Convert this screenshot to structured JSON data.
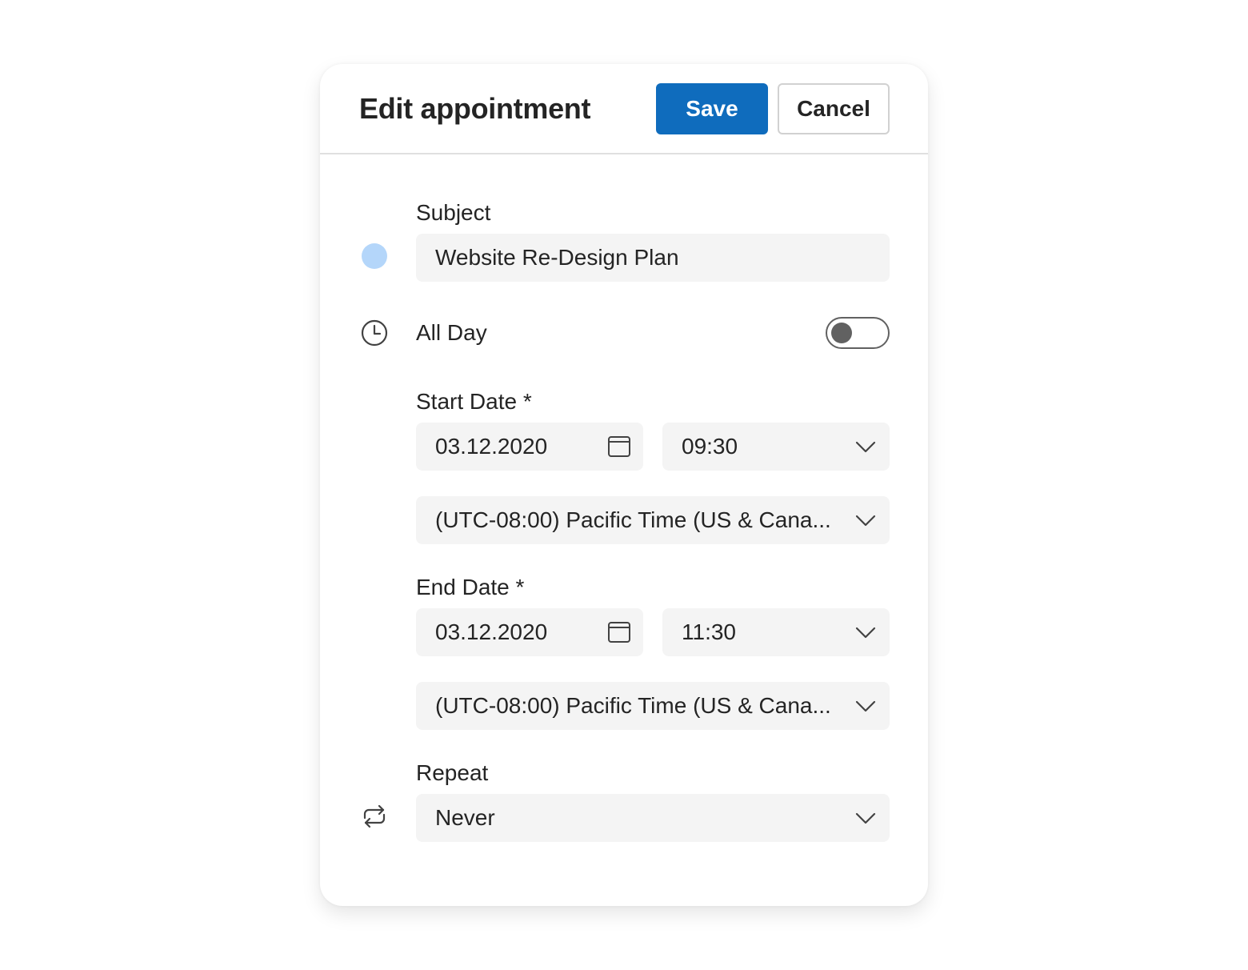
{
  "dialog": {
    "title": "Edit appointment",
    "save_label": "Save",
    "cancel_label": "Cancel",
    "accent_color": "#0f6cbd"
  },
  "subject": {
    "label": "Subject",
    "value": "Website Re-Design Plan",
    "category_color": "#b4d6fa"
  },
  "all_day": {
    "label": "All Day",
    "enabled": false
  },
  "start": {
    "label": "Start Date *",
    "date": "03.12.2020",
    "time": "09:30",
    "timezone": "(UTC-08:00) Pacific Time (US & Cana..."
  },
  "end": {
    "label": "End Date *",
    "date": "03.12.2020",
    "time": "11:30",
    "timezone": "(UTC-08:00) Pacific Time (US & Cana..."
  },
  "repeat": {
    "label": "Repeat",
    "value": "Never"
  },
  "icons": {
    "all_day": "clock-icon",
    "repeat": "repeat-icon",
    "date_picker": "calendar-icon",
    "dropdown": "chevron-down-icon"
  }
}
